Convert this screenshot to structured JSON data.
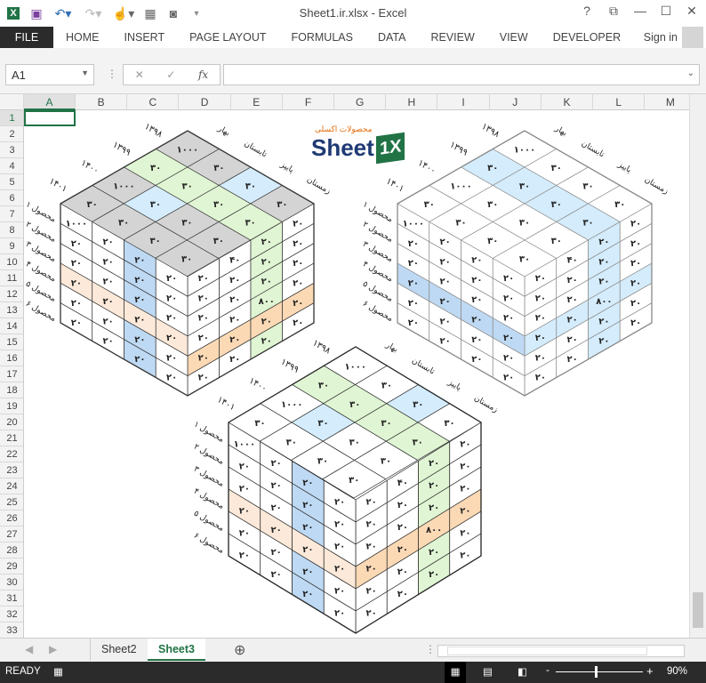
{
  "window": {
    "title": "Sheet1.ir.xlsx - Excel",
    "help": "?",
    "restore": "⧉",
    "minimize": "—",
    "maximize": "☐",
    "close": "✕"
  },
  "ribbon_tabs": [
    "FILE",
    "HOME",
    "INSERT",
    "PAGE LAYOUT",
    "FORMULAS",
    "DATA",
    "REVIEW",
    "VIEW",
    "DEVELOPER"
  ],
  "signin": "Sign in",
  "namebox": "A1",
  "formula": "",
  "fx": "fx",
  "columns": [
    "A",
    "B",
    "C",
    "D",
    "E",
    "F",
    "G",
    "H",
    "I",
    "J",
    "K",
    "L",
    "M"
  ],
  "rows": [
    "1",
    "2",
    "3",
    "4",
    "5",
    "6",
    "7",
    "8",
    "9",
    "10",
    "11",
    "12",
    "13",
    "14",
    "15",
    "16",
    "17",
    "18",
    "19",
    "20",
    "21",
    "22",
    "23",
    "24",
    "25",
    "26",
    "27",
    "28",
    "29",
    "30",
    "31",
    "32",
    "33"
  ],
  "logo": {
    "text": "Sheet",
    "mark": "1X",
    "tagline": "محصولات اکسلی"
  },
  "colors": {
    "g": "#d4d4d4",
    "G": "#e0f5d3",
    "b": "#d4ecfb",
    "B": "#bed9f3",
    "p": "#fde9d9",
    "o": "#fbd9b5",
    "w": "#ffffff"
  },
  "cubes": [
    {
      "years": [
        "۱۳۹۸",
        "۱۳۹۹",
        "۱۴۰۰",
        "۱۴۰۱"
      ],
      "seasons": [
        "بهار",
        "تابستان",
        "پاییز",
        "زمستان"
      ],
      "products": [
        "محصول ۱",
        "محصول ۲",
        "محصول ۳",
        "محصول ۴",
        "محصول ۵",
        "محصول ۶"
      ],
      "top": [
        [
          "۱۰۰۰",
          "۳۰",
          "۳۰",
          "۳۰"
        ],
        [
          "۳۰",
          "۳۰",
          "۳۰",
          "۳۰"
        ],
        [
          "۱۰۰۰",
          "۳۰",
          "۳۰",
          "۳۰"
        ],
        [
          "۳۰",
          "۳۰",
          "۳۰",
          "۳۰"
        ]
      ],
      "top_colors": [
        "ggbg",
        "GGGG",
        "gbgg",
        "gggg"
      ],
      "left": [
        [
          "۱۰۰۰",
          "۲۰",
          "۲۰",
          "۲۰"
        ],
        [
          "۲۰",
          "۲۰",
          "۲۰",
          "۲۰"
        ],
        [
          "۲۰",
          "۲۰",
          "۲۰",
          "۲۰"
        ],
        [
          "۲۰",
          "۲۰",
          "۲۰",
          "۲۰"
        ],
        [
          "۲۰",
          "۲۰",
          "۲۰",
          "۲۰"
        ],
        [
          "۲۰",
          "۲۰",
          "۲۰",
          "۲۰"
        ]
      ],
      "left_colors": [
        "wwBw",
        "wwBw",
        "wwBw",
        "pppp",
        "wwBw",
        "wwBw"
      ],
      "right": [
        [
          "۲۰",
          "۴۰",
          "۲۰",
          "۲۰"
        ],
        [
          "۲۰",
          "۲۰",
          "۲۰",
          "۲۰"
        ],
        [
          "۲۰",
          "۲۰",
          "۲۰",
          "۲۰"
        ],
        [
          "۲۰",
          "۲۰",
          "۸۰۰",
          "۲۰"
        ],
        [
          "۲۰",
          "۲۰",
          "۲۰",
          "۲۰"
        ],
        [
          "۲۰",
          "۲۰",
          "۲۰",
          "۲۰"
        ]
      ],
      "right_colors": [
        "wwGw",
        "wwGw",
        "wwGw",
        "wwGw",
        "oooo",
        "wwGw"
      ]
    },
    {
      "years": [
        "۱۳۹۸",
        "۱۳۹۹",
        "۱۴۰۰",
        "۱۴۰۱"
      ],
      "seasons": [
        "بهار",
        "تابستان",
        "پاییز",
        "زمستان"
      ],
      "products": [
        "محصول ۱",
        "محصول ۲",
        "محصول ۳",
        "محصول ۴",
        "محصول ۵",
        "محصول ۶"
      ],
      "top": [
        [
          "۱۰۰۰",
          "۳۰",
          "۳۰",
          "۳۰"
        ],
        [
          "۳۰",
          "۳۰",
          "۳۰",
          "۳۰"
        ],
        [
          "۱۰۰۰",
          "۳۰",
          "۳۰",
          "۳۰"
        ],
        [
          "۳۰",
          "۳۰",
          "۳۰",
          "۳۰"
        ]
      ],
      "top_colors": [
        "wwww",
        "bbbb",
        "wwww",
        "wwww"
      ],
      "left": [
        [
          "۱۰۰۰",
          "۲۰",
          "۲۰",
          "۲۰"
        ],
        [
          "۲۰",
          "۲۰",
          "۲۰",
          "۲۰"
        ],
        [
          "۲۰",
          "۲۰",
          "۲۰",
          "۲۰"
        ],
        [
          "۲۰",
          "۲۰",
          "۲۰",
          "۲۰"
        ],
        [
          "۲۰",
          "۲۰",
          "۲۰",
          "۲۰"
        ],
        [
          "۲۰",
          "۲۰",
          "۲۰",
          "۲۰"
        ]
      ],
      "left_colors": [
        "wwww",
        "wwww",
        "wwww",
        "BBBB",
        "wwww",
        "wwww"
      ],
      "right": [
        [
          "۲۰",
          "۴۰",
          "۲۰",
          "۲۰"
        ],
        [
          "۲۰",
          "۲۰",
          "۲۰",
          "۲۰"
        ],
        [
          "۲۰",
          "۲۰",
          "۲۰",
          "۲۰"
        ],
        [
          "۲۰",
          "۲۰",
          "۸۰۰",
          "۲۰"
        ],
        [
          "۲۰",
          "۲۰",
          "۲۰",
          "۲۰"
        ],
        [
          "۲۰",
          "۲۰",
          "۲۰",
          "۲۰"
        ]
      ],
      "right_colors": [
        "wwbw",
        "wwbw",
        "wwbw",
        "bbbb",
        "wwbw",
        "wwbw"
      ]
    },
    {
      "years": [
        "۱۳۹۸",
        "۱۳۹۹",
        "۱۴۰۰",
        "۱۴۰۱"
      ],
      "seasons": [
        "بهار",
        "تابستان",
        "پاییز",
        "زمستان"
      ],
      "products": [
        "محصول ۱",
        "محصول ۲",
        "محصول ۳",
        "محصول ۴",
        "محصول ۵",
        "محصول ۶"
      ],
      "top": [
        [
          "۱۰۰۰",
          "۳۰",
          "۳۰",
          "۳۰"
        ],
        [
          "۳۰",
          "۳۰",
          "۳۰",
          "۳۰"
        ],
        [
          "۱۰۰۰",
          "۳۰",
          "۳۰",
          "۳۰"
        ],
        [
          "۳۰",
          "۳۰",
          "۳۰",
          "۳۰"
        ]
      ],
      "top_colors": [
        "wwbw",
        "GGGG",
        "wbww",
        "wwww"
      ],
      "left": [
        [
          "۱۰۰۰",
          "۲۰",
          "۲۰",
          "۲۰"
        ],
        [
          "۲۰",
          "۲۰",
          "۲۰",
          "۲۰"
        ],
        [
          "۲۰",
          "۲۰",
          "۲۰",
          "۲۰"
        ],
        [
          "۲۰",
          "۲۰",
          "۲۰",
          "۲۰"
        ],
        [
          "۲۰",
          "۲۰",
          "۲۰",
          "۲۰"
        ],
        [
          "۲۰",
          "۲۰",
          "۲۰",
          "۲۰"
        ]
      ],
      "left_colors": [
        "wwBw",
        "wwBw",
        "wwBw",
        "pppp",
        "wwBw",
        "wwBw"
      ],
      "right": [
        [
          "۲۰",
          "۴۰",
          "۲۰",
          "۲۰"
        ],
        [
          "۲۰",
          "۲۰",
          "۲۰",
          "۲۰"
        ],
        [
          "۲۰",
          "۲۰",
          "۲۰",
          "۲۰"
        ],
        [
          "۲۰",
          "۲۰",
          "۸۰۰",
          "۲۰"
        ],
        [
          "۲۰",
          "۲۰",
          "۲۰",
          "۲۰"
        ],
        [
          "۲۰",
          "۲۰",
          "۲۰",
          "۲۰"
        ]
      ],
      "right_colors": [
        "wwGw",
        "wwGw",
        "wwGw",
        "oooo",
        "wwGw",
        "wwGw"
      ]
    }
  ],
  "sheets": [
    "Sheet2",
    "Sheet3"
  ],
  "active_sheet": "Sheet3",
  "status": {
    "ready": "READY",
    "zoom": "90%",
    "zoom_minus": "-",
    "zoom_plus": "+"
  }
}
